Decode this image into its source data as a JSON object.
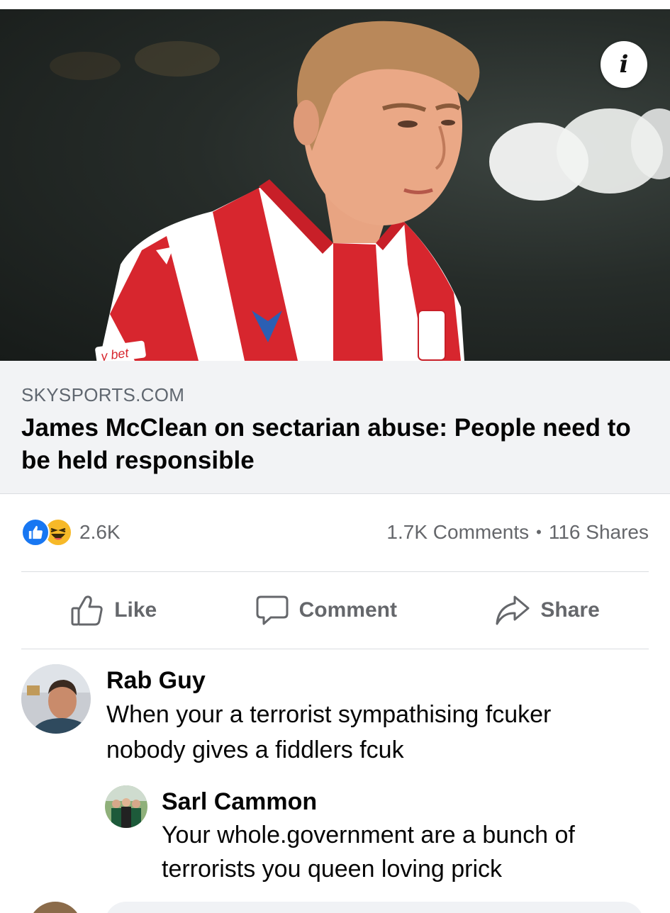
{
  "link_preview": {
    "source": "SKYSPORTS.COM",
    "title": "James McClean on sectarian abuse: People need to be held responsible",
    "info_label": "i",
    "sponsor_text": "y bet"
  },
  "stats": {
    "reaction_count": "2.6K",
    "comments": "1.7K Comments",
    "separator": "•",
    "shares": "116 Shares"
  },
  "actions": {
    "like": "Like",
    "comment": "Comment",
    "share": "Share"
  },
  "comments": [
    {
      "author": "Rab Guy",
      "text": "When your a terrorist sympathising fcuker nobody gives a fiddlers fcuk"
    },
    {
      "author": "Sarl Cammon",
      "text": "Your whole.government are a bunch of terrorists you queen loving prick"
    }
  ],
  "colors": {
    "like_blue": "#1877f2",
    "haha_yellow": "#f7b928",
    "muted_text": "#65676b",
    "card_bg": "#f2f3f5"
  },
  "icons": [
    "info-icon",
    "like-reaction-icon",
    "haha-reaction-icon",
    "thumbs-up-icon",
    "comment-bubble-icon",
    "share-arrow-icon"
  ]
}
